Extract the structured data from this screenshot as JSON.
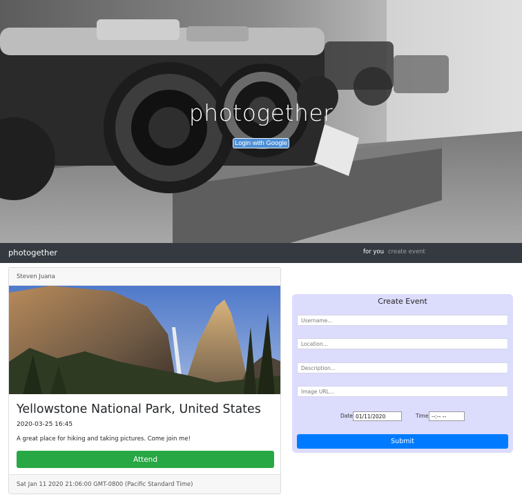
{
  "hero": {
    "title": "photogether",
    "login_label": "Login with Google"
  },
  "navbar": {
    "brand": "photogether",
    "links": [
      {
        "label": "for you",
        "active": true
      },
      {
        "label": "create event",
        "active": false
      }
    ]
  },
  "event_card": {
    "author": "Steven Juana",
    "title": "Yellowstone National Park, United States",
    "datetime": "2020-03-25 16:45",
    "description": "A great place for hiking and taking pictures. Come join me!",
    "attend_label": "Attend",
    "footer": "Sat Jan 11 2020 21:06:00 GMT-0800 (Pacific Standard Time)"
  },
  "create_event": {
    "title": "Create Event",
    "username_placeholder": "Username...",
    "location_placeholder": "Location...",
    "description_placeholder": "Description...",
    "image_placeholder": "Image URL...",
    "date_label": "Date",
    "date_value": "01/11/2020",
    "time_label": "Time",
    "time_value": "--:-- --",
    "submit_label": "Submit"
  },
  "colors": {
    "navbar": "#343a40",
    "attend": "#28a745",
    "submit": "#007bff",
    "form_bg": "#dcdcfd",
    "login": "#4e8fd6"
  }
}
